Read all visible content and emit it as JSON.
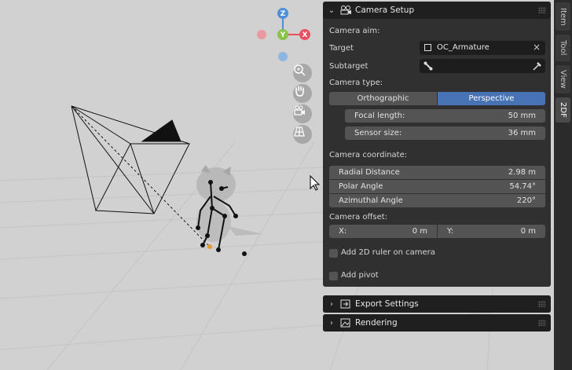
{
  "tabs": [
    {
      "label": "Item",
      "active": false
    },
    {
      "label": "Tool",
      "active": false
    },
    {
      "label": "View",
      "active": false
    },
    {
      "label": "2DF",
      "active": true
    }
  ],
  "gizmo": {
    "z_label": "Z",
    "y_label": "Y",
    "x_label": "X"
  },
  "camera_setup": {
    "title": "Camera Setup",
    "aim_label": "Camera aim:",
    "target_label": "Target",
    "target_value": "OC_Armature",
    "subtarget_label": "Subtarget",
    "type_label": "Camera type:",
    "type_options": [
      "Orthographic",
      "Perspective"
    ],
    "type_selected": "Perspective",
    "focal_label": "Focal length:",
    "focal_value": "50 mm",
    "sensor_label": "Sensor size:",
    "sensor_value": "36 mm",
    "coord_label": "Camera coordinate:",
    "radial_label": "Radial Distance",
    "radial_value": "2.98 m",
    "polar_label": "Polar Angle",
    "polar_value": "54.74°",
    "azimuth_label": "Azimuthal Angle",
    "azimuth_value": "220°",
    "offset_label": "Camera offset:",
    "offset_x_label": "X:",
    "offset_x_value": "0 m",
    "offset_y_label": "Y:",
    "offset_y_value": "0 m",
    "ruler_label": "Add 2D ruler on camera",
    "ruler_checked": false,
    "pivot_label": "Add pivot",
    "pivot_checked": false
  },
  "export_settings": {
    "title": "Export Settings"
  },
  "rendering": {
    "title": "Rendering"
  },
  "colors": {
    "accent": "#4772b3",
    "x_axis": "#e8505f",
    "y_axis": "#8bc24a",
    "z_axis": "#4f8fd6"
  }
}
